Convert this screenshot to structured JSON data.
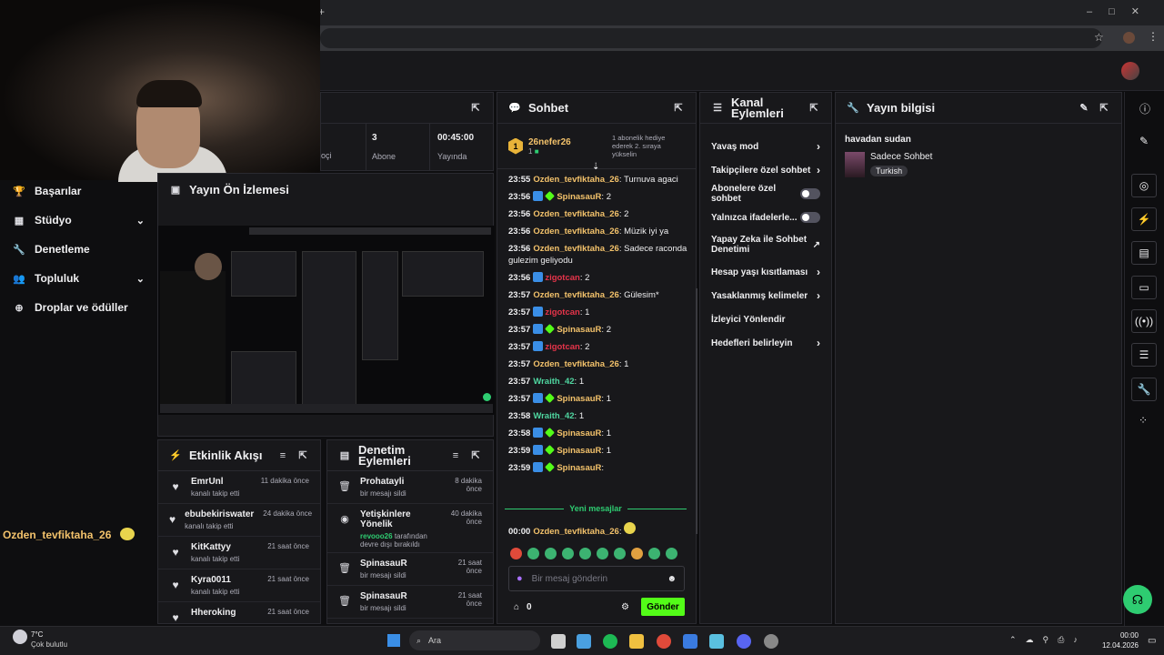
{
  "sidenav": {
    "items": [
      {
        "label": "Başarılar",
        "icon": "trophy-icon"
      },
      {
        "label": "Stüdyo",
        "icon": "studio-icon"
      },
      {
        "label": "Denetleme",
        "icon": "wrench-icon"
      },
      {
        "label": "Topluluk",
        "icon": "community-icon"
      },
      {
        "label": "Droplar ve ödüller",
        "icon": "drops-icon"
      }
    ],
    "highlight_user": "Ozden_tevfiktaha_26"
  },
  "stats": {
    "subs_value": "3",
    "subs_label": "Abone",
    "time_value": "00:45:00",
    "time_label": "Yayında",
    "viewers_label": "İzleyici"
  },
  "preview": {
    "title": "Yayın Ön İzlemesi"
  },
  "activity": {
    "title": "Etkinlik Akışı",
    "items": [
      {
        "name": "EmrUnl",
        "sub": "kanalı takip etti",
        "time": "11 dakika önce"
      },
      {
        "name": "ebubekiriswater",
        "sub": "kanalı takip etti",
        "time": "24 dakika önce"
      },
      {
        "name": "KitKattyy",
        "sub": "kanalı takip etti",
        "time": "21 saat önce"
      },
      {
        "name": "Kyra0011",
        "sub": "kanalı takip etti",
        "time": "21 saat önce"
      },
      {
        "name": "Hheroking",
        "sub": "",
        "time": "21 saat önce"
      }
    ]
  },
  "mod": {
    "title": "Denetim Eylemleri",
    "items": [
      {
        "name": "Prohatayli",
        "sub": "bir mesajı sildi",
        "time": "8 dakika önce",
        "icon": "trash-icon"
      },
      {
        "name": "Yetişkinlere Yönelik",
        "sub2_user": "revooo26",
        "sub": "tarafından devre dışı bırakıldı",
        "time": "40 dakika önce",
        "icon": "eye-icon"
      },
      {
        "name": "SpinasauR",
        "sub": "bir mesajı sildi",
        "time": "21 saat önce",
        "icon": "trash-icon"
      },
      {
        "name": "SpinasauR",
        "sub": "bir mesajı sildi",
        "time": "21 saat önce",
        "icon": "trash-icon"
      }
    ]
  },
  "chat": {
    "title": "Sohbet",
    "pinned_user": "26nefer26",
    "pinned_count": "1",
    "pinned_level": "1",
    "pinned_note": "1 abonelik hediye ederek 2. sıraya yükselin",
    "messages": [
      {
        "time": "23:55",
        "user": "Ozden_tevfiktaha_26",
        "color": "#f3c26b",
        "badges": 0,
        "text": "Turnuva agaci"
      },
      {
        "time": "23:56",
        "user": "SpinasauR",
        "color": "#f3c26b",
        "badges": 2,
        "text": "2"
      },
      {
        "time": "23:56",
        "user": "Ozden_tevfiktaha_26",
        "color": "#f3c26b",
        "badges": 0,
        "text": "2"
      },
      {
        "time": "23:56",
        "user": "Ozden_tevfiktaha_26",
        "color": "#f3c26b",
        "badges": 0,
        "text": "Müzik iyi ya"
      },
      {
        "time": "23:56",
        "user": "Ozden_tevfiktaha_26",
        "color": "#f3c26b",
        "badges": 0,
        "text": "Sadece raconda gulezim geliyodu"
      },
      {
        "time": "23:56",
        "user": "zigotcan",
        "color": "#e5344a",
        "badges": 1,
        "text": "2"
      },
      {
        "time": "23:57",
        "user": "Ozden_tevfiktaha_26",
        "color": "#f3c26b",
        "badges": 0,
        "text": "Gülesim*"
      },
      {
        "time": "23:57",
        "user": "zigotcan",
        "color": "#e5344a",
        "badges": 1,
        "text": "1"
      },
      {
        "time": "23:57",
        "user": "SpinasauR",
        "color": "#f3c26b",
        "badges": 2,
        "text": "2"
      },
      {
        "time": "23:57",
        "user": "zigotcan",
        "color": "#e5344a",
        "badges": 1,
        "text": "2"
      },
      {
        "time": "23:57",
        "user": "Ozden_tevfiktaha_26",
        "color": "#f3c26b",
        "badges": 0,
        "text": "1"
      },
      {
        "time": "23:57",
        "user": "Wraith_42",
        "color": "#4fd6a0",
        "badges": 0,
        "text": "1"
      },
      {
        "time": "23:57",
        "user": "SpinasauR",
        "color": "#f3c26b",
        "badges": 2,
        "text": "1"
      },
      {
        "time": "23:58",
        "user": "Wraith_42",
        "color": "#4fd6a0",
        "badges": 0,
        "text": "1"
      },
      {
        "time": "23:58",
        "user": "SpinasauR",
        "color": "#f3c26b",
        "badges": 2,
        "text": "1"
      },
      {
        "time": "23:59",
        "user": "SpinasauR",
        "color": "#f3c26b",
        "badges": 2,
        "text": "1"
      },
      {
        "time": "23:59",
        "user": "SpinasauR",
        "color": "#f3c26b",
        "badges": 2,
        "text": ""
      }
    ],
    "new_messages_label": "Yeni mesajlar",
    "last_time": "00:00",
    "last_user": "Ozden_tevfiktaha_26",
    "input_placeholder": "Bir mesaj gönderin",
    "points": "0",
    "send_label": "Gönder"
  },
  "channel_actions": {
    "title": "Kanal Eylemleri",
    "items": [
      {
        "label": "Yavaş mod",
        "control": "chevron"
      },
      {
        "label": "Takipçilere özel sohbet",
        "control": "chevron"
      },
      {
        "label": "Abonelere özel sohbet",
        "control": "toggle"
      },
      {
        "label": "Yalnızca ifadelerle...",
        "control": "toggle"
      },
      {
        "label": "Yapay Zeka ile Sohbet Denetimi",
        "control": "external"
      },
      {
        "label": "Hesap yaşı kısıtlaması",
        "control": "chevron"
      },
      {
        "label": "Yasaklanmış kelimeler",
        "control": "chevron"
      },
      {
        "label": "İzleyici Yönlendir",
        "control": "none"
      },
      {
        "label": "Hedefleri belirleyin",
        "control": "chevron"
      }
    ]
  },
  "stream_info": {
    "title": "Yayın bilgisi",
    "stream_title": "havadan sudan",
    "category": "Sadece Sohbet",
    "language": "Turkish"
  },
  "taskbar": {
    "weather_temp": "7°C",
    "weather_desc": "Çok bulutlu",
    "search_label": "Ara",
    "clock_time": "00:00",
    "clock_date": "12.04.2026"
  }
}
